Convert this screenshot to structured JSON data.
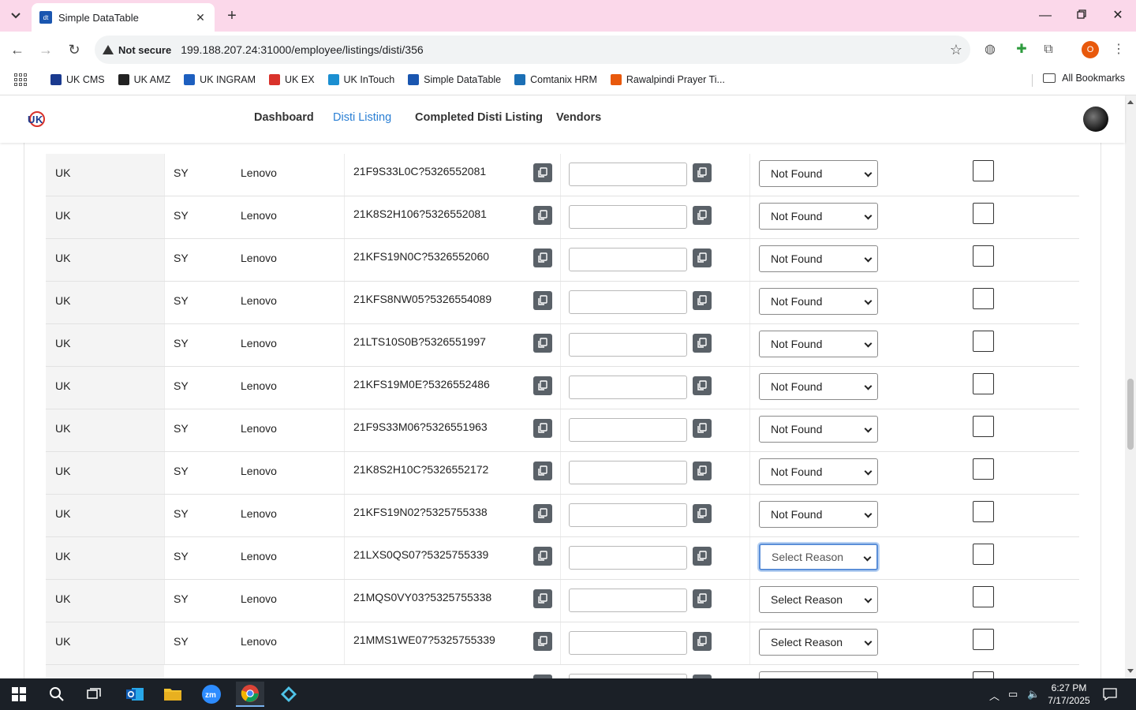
{
  "browser": {
    "tab_title": "Simple DataTable",
    "tab_favicon_text": "dt",
    "security_label": "Not secure",
    "url": "199.188.207.24:31000/employee/listings/disti/356",
    "profile_initial": "O",
    "bookmarks": [
      {
        "label": "UK CMS",
        "color": "#1a3a8f"
      },
      {
        "label": "UK AMZ",
        "color": "#222222"
      },
      {
        "label": "UK INGRAM",
        "color": "#1d5fbf"
      },
      {
        "label": "UK EX",
        "color": "#d9322b"
      },
      {
        "label": "UK InTouch",
        "color": "#1b8fd1"
      },
      {
        "label": "Simple DataTable",
        "color": "#1a56b0"
      },
      {
        "label": "Comtanix HRM",
        "color": "#1b6fb5"
      },
      {
        "label": "Rawalpindi Prayer Ti...",
        "color": "#e8590c"
      }
    ],
    "all_bookmarks_label": "All Bookmarks"
  },
  "app_nav": {
    "links": [
      {
        "label": "Dashboard",
        "active": false
      },
      {
        "label": "Disti Listing",
        "active": true
      },
      {
        "label": "Completed Disti Listing",
        "active": false
      },
      {
        "label": "Vendors",
        "active": false
      }
    ],
    "active_color": "#2a7fd4"
  },
  "table": {
    "rows": [
      {
        "country": "UK",
        "code": "SY",
        "brand": "Lenovo",
        "part": "21F9S33L0C?5326552081",
        "input_value": "",
        "reason": "Not Found",
        "checked": false
      },
      {
        "country": "UK",
        "code": "SY",
        "brand": "Lenovo",
        "part": "21K8S2H106?5326552081",
        "input_value": "",
        "reason": "Not Found",
        "checked": false
      },
      {
        "country": "UK",
        "code": "SY",
        "brand": "Lenovo",
        "part": "21KFS19N0C?5326552060",
        "input_value": "",
        "reason": "Not Found",
        "checked": false
      },
      {
        "country": "UK",
        "code": "SY",
        "brand": "Lenovo",
        "part": "21KFS8NW05?5326554089",
        "input_value": "",
        "reason": "Not Found",
        "checked": false
      },
      {
        "country": "UK",
        "code": "SY",
        "brand": "Lenovo",
        "part": "21LTS10S0B?5326551997",
        "input_value": "",
        "reason": "Not Found",
        "checked": false
      },
      {
        "country": "UK",
        "code": "SY",
        "brand": "Lenovo",
        "part": "21KFS19M0E?5326552486",
        "input_value": "",
        "reason": "Not Found",
        "checked": false
      },
      {
        "country": "UK",
        "code": "SY",
        "brand": "Lenovo",
        "part": "21F9S33M06?5326551963",
        "input_value": "",
        "reason": "Not Found",
        "checked": false
      },
      {
        "country": "UK",
        "code": "SY",
        "brand": "Lenovo",
        "part": "21K8S2H10C?5326552172",
        "input_value": "",
        "reason": "Not Found",
        "checked": false
      },
      {
        "country": "UK",
        "code": "SY",
        "brand": "Lenovo",
        "part": "21KFS19N02?5325755338",
        "input_value": "",
        "reason": "Not Found",
        "checked": false
      },
      {
        "country": "UK",
        "code": "SY",
        "brand": "Lenovo",
        "part": "21LXS0QS07?5325755339",
        "input_value": "",
        "reason": "Select Reason",
        "checked": false,
        "focused": true
      },
      {
        "country": "UK",
        "code": "SY",
        "brand": "Lenovo",
        "part": "21MQS0VY03?5325755338",
        "input_value": "",
        "reason": "Select Reason",
        "checked": false
      },
      {
        "country": "UK",
        "code": "SY",
        "brand": "Lenovo",
        "part": "21MMS1WE07?5325755339",
        "input_value": "",
        "reason": "Select Reason",
        "checked": false
      }
    ]
  },
  "taskbar": {
    "time": "6:27 PM",
    "date": "7/17/2025"
  }
}
